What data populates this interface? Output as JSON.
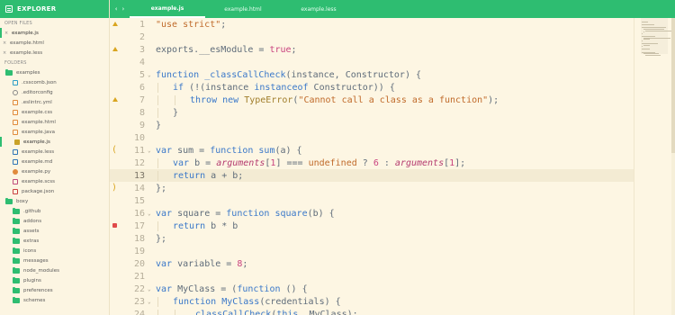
{
  "sidebar": {
    "title": "EXPLORER",
    "open_files_label": "OPEN FILES",
    "open_files": [
      {
        "name": "example.js",
        "active": true
      },
      {
        "name": "example.html",
        "active": false
      },
      {
        "name": "example.less",
        "active": false
      }
    ],
    "folders_label": "FOLDERS",
    "tree": [
      {
        "name": "examples",
        "kind": "folder",
        "icon": "folder-open-icon",
        "level": "root",
        "active": false
      },
      {
        "name": ".csscomb.json",
        "kind": "file",
        "icon": "json-file-icon",
        "cls": "ic-json",
        "level": "file",
        "active": false
      },
      {
        "name": ".editorconfig",
        "kind": "file",
        "icon": "gear-file-icon",
        "cls": "ic-gear",
        "level": "file",
        "active": false
      },
      {
        "name": ".eslintrc.yml",
        "kind": "file",
        "icon": "yml-file-icon",
        "cls": "ic-yml",
        "level": "file",
        "active": false
      },
      {
        "name": "example.css",
        "kind": "file",
        "icon": "css-file-icon",
        "cls": "ic-css",
        "level": "file",
        "active": false
      },
      {
        "name": "example.html",
        "kind": "file",
        "icon": "html-file-icon",
        "cls": "ic-html",
        "level": "file",
        "active": false
      },
      {
        "name": "example.java",
        "kind": "file",
        "icon": "java-file-icon",
        "cls": "ic-java",
        "level": "file",
        "active": false
      },
      {
        "name": "example.js",
        "kind": "file",
        "icon": "js-file-icon",
        "cls": "ic-js",
        "level": "file",
        "active": true
      },
      {
        "name": "example.less",
        "kind": "file",
        "icon": "less-file-icon",
        "cls": "ic-less",
        "level": "file",
        "active": false
      },
      {
        "name": "example.md",
        "kind": "file",
        "icon": "markdown-file-icon",
        "cls": "ic-md",
        "level": "file",
        "active": false
      },
      {
        "name": "example.py",
        "kind": "file",
        "icon": "python-file-icon",
        "cls": "ic-py",
        "level": "file",
        "active": false
      },
      {
        "name": "example.scss",
        "kind": "file",
        "icon": "scss-file-icon",
        "cls": "ic-scss",
        "level": "file",
        "active": false
      },
      {
        "name": "package.json",
        "kind": "file",
        "icon": "npm-file-icon",
        "cls": "ic-pjson",
        "level": "file",
        "active": false
      },
      {
        "name": "boxy",
        "kind": "folder",
        "icon": "folder-open-icon",
        "level": "root",
        "active": false
      },
      {
        "name": ".github",
        "kind": "folder",
        "icon": "folder-icon",
        "level": "sub",
        "active": false
      },
      {
        "name": "addons",
        "kind": "folder",
        "icon": "folder-icon",
        "level": "sub",
        "active": false
      },
      {
        "name": "assets",
        "kind": "folder",
        "icon": "folder-icon",
        "level": "sub",
        "active": false
      },
      {
        "name": "extras",
        "kind": "folder",
        "icon": "folder-icon",
        "level": "sub",
        "active": false
      },
      {
        "name": "icons",
        "kind": "folder",
        "icon": "folder-icon",
        "level": "sub",
        "active": false
      },
      {
        "name": "messages",
        "kind": "folder",
        "icon": "folder-icon",
        "level": "sub",
        "active": false
      },
      {
        "name": "node_modules",
        "kind": "folder",
        "icon": "folder-icon",
        "level": "sub",
        "active": false
      },
      {
        "name": "plugins",
        "kind": "folder",
        "icon": "folder-icon",
        "level": "sub",
        "active": false
      },
      {
        "name": "preferences",
        "kind": "folder",
        "icon": "folder-icon",
        "level": "sub",
        "active": false
      },
      {
        "name": "schemes",
        "kind": "folder",
        "icon": "folder-icon",
        "level": "sub",
        "active": false
      }
    ]
  },
  "tabs": [
    {
      "label": "example.js",
      "active": true
    },
    {
      "label": "example.html",
      "active": false
    },
    {
      "label": "example.less",
      "active": false
    }
  ],
  "nav": {
    "back": "‹",
    "forward": "›"
  },
  "editor": {
    "current_line": 13,
    "lines": [
      {
        "n": "1",
        "mark": "warn",
        "fold": "",
        "indent": 0,
        "tokens": [
          [
            "s",
            "\"use strict\""
          ],
          [
            "p",
            ";"
          ]
        ]
      },
      {
        "n": "2",
        "mark": "",
        "fold": "",
        "indent": 0,
        "tokens": []
      },
      {
        "n": "3",
        "mark": "warn",
        "fold": "",
        "indent": 0,
        "tokens": [
          [
            "p",
            "exports.__esModule = "
          ],
          [
            "n",
            "true"
          ],
          [
            "p",
            ";"
          ]
        ]
      },
      {
        "n": "4",
        "mark": "",
        "fold": "",
        "indent": 0,
        "tokens": []
      },
      {
        "n": "5",
        "mark": "",
        "fold": "⌄",
        "indent": 0,
        "tokens": [
          [
            "k",
            "function "
          ],
          [
            "f",
            "_classCallCheck"
          ],
          [
            "p",
            "(instance, Constructor) {"
          ]
        ]
      },
      {
        "n": "6",
        "mark": "",
        "fold": "",
        "indent": 1,
        "tokens": [
          [
            "k",
            "if "
          ],
          [
            "p",
            "(!(instance "
          ],
          [
            "k",
            "instanceof "
          ],
          [
            "p",
            "Constructor)) {"
          ]
        ]
      },
      {
        "n": "7",
        "mark": "warn",
        "fold": "",
        "indent": 2,
        "tokens": [
          [
            "k",
            "throw new "
          ],
          [
            "t",
            "TypeError"
          ],
          [
            "p",
            "("
          ],
          [
            "s",
            "\"Cannot call a class as a function\""
          ],
          [
            "p",
            ");"
          ]
        ]
      },
      {
        "n": "8",
        "mark": "",
        "fold": "",
        "indent": 1,
        "tokens": [
          [
            "p",
            "}"
          ]
        ]
      },
      {
        "n": "9",
        "mark": "",
        "fold": "",
        "indent": 0,
        "tokens": [
          [
            "p",
            "}"
          ]
        ]
      },
      {
        "n": "10",
        "mark": "",
        "fold": "",
        "indent": 0,
        "tokens": []
      },
      {
        "n": "11",
        "mark": "bracket-open",
        "fold": "⌄",
        "indent": 0,
        "tokens": [
          [
            "k",
            "var "
          ],
          [
            "p",
            "sum = "
          ],
          [
            "k",
            "function "
          ],
          [
            "f",
            "sum"
          ],
          [
            "p",
            "(a) {"
          ]
        ]
      },
      {
        "n": "12",
        "mark": "",
        "fold": "",
        "indent": 1,
        "tokens": [
          [
            "k",
            "var "
          ],
          [
            "p",
            "b = "
          ],
          [
            "v",
            "arguments"
          ],
          [
            "p",
            "["
          ],
          [
            "n",
            "1"
          ],
          [
            "p",
            "] === "
          ],
          [
            "u",
            "undefined"
          ],
          [
            "p",
            " ? "
          ],
          [
            "n",
            "6"
          ],
          [
            "p",
            " : "
          ],
          [
            "v",
            "arguments"
          ],
          [
            "p",
            "["
          ],
          [
            "n",
            "1"
          ],
          [
            "p",
            "];"
          ]
        ]
      },
      {
        "n": "13",
        "mark": "",
        "fold": "",
        "indent": 1,
        "tokens": [
          [
            "k",
            "return "
          ],
          [
            "p",
            "a + b;"
          ]
        ]
      },
      {
        "n": "14",
        "mark": "bracket-close",
        "fold": "",
        "indent": 0,
        "tokens": [
          [
            "p",
            "};"
          ]
        ]
      },
      {
        "n": "15",
        "mark": "",
        "fold": "",
        "indent": 0,
        "tokens": []
      },
      {
        "n": "16",
        "mark": "",
        "fold": "⌄",
        "indent": 0,
        "tokens": [
          [
            "k",
            "var "
          ],
          [
            "p",
            "square = "
          ],
          [
            "k",
            "function "
          ],
          [
            "f",
            "square"
          ],
          [
            "p",
            "(b) {"
          ]
        ]
      },
      {
        "n": "17",
        "mark": "error",
        "fold": "",
        "indent": 1,
        "tokens": [
          [
            "k",
            "return "
          ],
          [
            "p",
            "b * b"
          ],
          [
            "p",
            ""
          ]
        ]
      },
      {
        "n": "18",
        "mark": "",
        "fold": "",
        "indent": 0,
        "tokens": [
          [
            "p",
            "};"
          ]
        ]
      },
      {
        "n": "19",
        "mark": "",
        "fold": "",
        "indent": 0,
        "tokens": []
      },
      {
        "n": "20",
        "mark": "",
        "fold": "",
        "indent": 0,
        "tokens": [
          [
            "k",
            "var "
          ],
          [
            "p",
            "variable = "
          ],
          [
            "n",
            "8"
          ],
          [
            "p",
            ";"
          ]
        ]
      },
      {
        "n": "21",
        "mark": "",
        "fold": "",
        "indent": 0,
        "tokens": []
      },
      {
        "n": "22",
        "mark": "",
        "fold": "⌄",
        "indent": 0,
        "tokens": [
          [
            "k",
            "var "
          ],
          [
            "p",
            "MyClass = ("
          ],
          [
            "k",
            "function "
          ],
          [
            "p",
            "() {"
          ]
        ]
      },
      {
        "n": "23",
        "mark": "",
        "fold": "⌄",
        "indent": 1,
        "tokens": [
          [
            "k",
            "function "
          ],
          [
            "f",
            "MyClass"
          ],
          [
            "p",
            "(credentials) {"
          ]
        ]
      },
      {
        "n": "24",
        "mark": "",
        "fold": "",
        "indent": 2,
        "tokens": [
          [
            "f",
            "_classCallCheck"
          ],
          [
            "p",
            "("
          ],
          [
            "k",
            "this"
          ],
          [
            "p",
            ", MyClass);"
          ]
        ]
      }
    ]
  },
  "colors": {
    "accent": "#2ebd71",
    "background": "#fdf6e3",
    "warning": "#d9a520",
    "error": "#e04a4a"
  }
}
